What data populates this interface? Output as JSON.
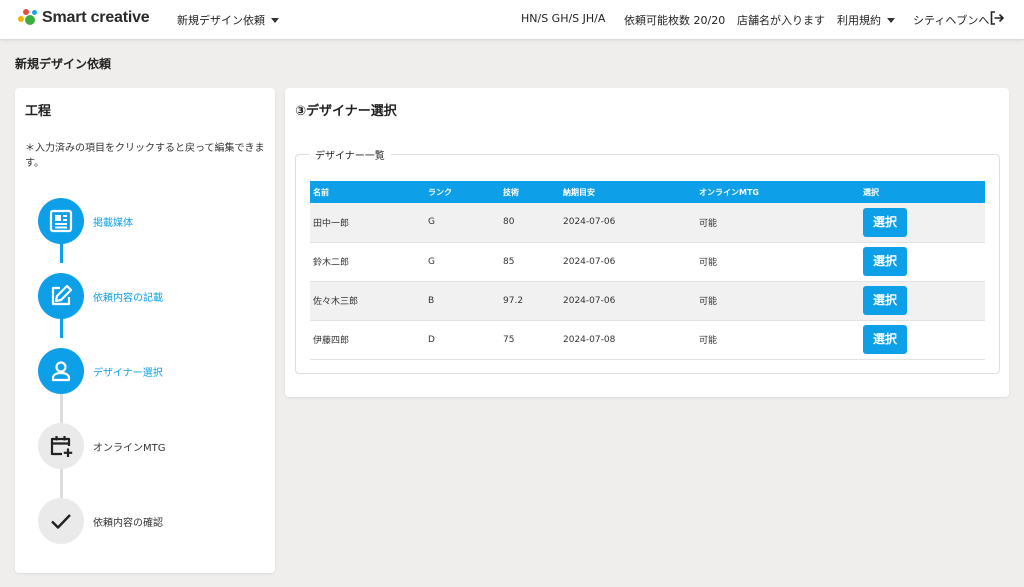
{
  "header": {
    "logo_text": "Smart creative",
    "menu_new_request": "新規デザイン依頼",
    "codes": "HN/S GH/S JH/A",
    "available_count": "依頼可能枚数 20/20",
    "store_name": "店舗名が入ります",
    "terms": "利用規約",
    "user": "シティヘブンへ"
  },
  "page_title": "新規デザイン依頼",
  "process": {
    "title": "工程",
    "note": "＊入力済みの項目をクリックすると戻って編集できます。",
    "steps": [
      {
        "label": "掲載媒体",
        "icon": "newspaper-icon",
        "state": "active"
      },
      {
        "label": "依頼内容の記載",
        "icon": "edit-icon",
        "state": "active"
      },
      {
        "label": "デザイナー選択",
        "icon": "person-icon",
        "state": "active"
      },
      {
        "label": "オンラインMTG",
        "icon": "calendar-plus-icon",
        "state": "inactive"
      },
      {
        "label": "依頼内容の確認",
        "icon": "check-icon",
        "state": "inactive"
      }
    ]
  },
  "designer_section": {
    "title": "③デザイナー選択",
    "list_title": "デザイナー一覧",
    "columns": [
      "名前",
      "ランク",
      "技術",
      "納期目安",
      "オンラインMTG",
      "選択"
    ],
    "rows": [
      {
        "name": "田中一郎",
        "rank": "G",
        "skill": "80",
        "due": "2024-07-06",
        "mtg": "可能",
        "button": "選択"
      },
      {
        "name": "鈴木二郎",
        "rank": "G",
        "skill": "85",
        "due": "2024-07-06",
        "mtg": "可能",
        "button": "選択"
      },
      {
        "name": "佐々木三郎",
        "rank": "B",
        "skill": "97.2",
        "due": "2024-07-06",
        "mtg": "可能",
        "button": "選択"
      },
      {
        "name": "伊藤四郎",
        "rank": "D",
        "skill": "75",
        "due": "2024-07-08",
        "mtg": "可能",
        "button": "選択"
      }
    ]
  },
  "colors": {
    "accent": "#0da0e8",
    "background": "#efeeec",
    "inactive_circle": "#eaeaea"
  }
}
